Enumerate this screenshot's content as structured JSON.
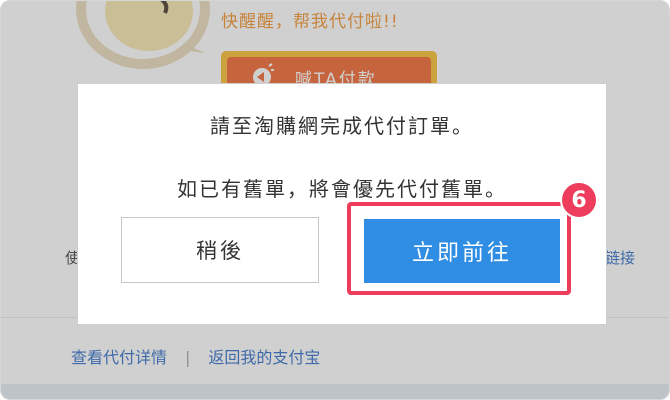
{
  "background_page": {
    "headline": "快醒醒，帮我代付啦!!",
    "pay_button_label": "喊TA付款",
    "left_edge_text": "使",
    "right_link_text": "链接",
    "footer_links": {
      "view_details": "查看代付详情",
      "separator": "|",
      "back_to_alipay": "返回我的支付宝"
    }
  },
  "dialog": {
    "message_line1": "請至淘購網完成代付訂單。",
    "message_line2": "如已有舊單，將會優先代付舊單。",
    "later_button": "稍後",
    "go_now_button": "立即前往"
  },
  "annotation": {
    "step_number": "6",
    "highlight_color": "#ee3d5c"
  },
  "colors": {
    "primary_button": "#2f8de4",
    "link": "#1f63c4",
    "headline": "#f08a1c"
  }
}
